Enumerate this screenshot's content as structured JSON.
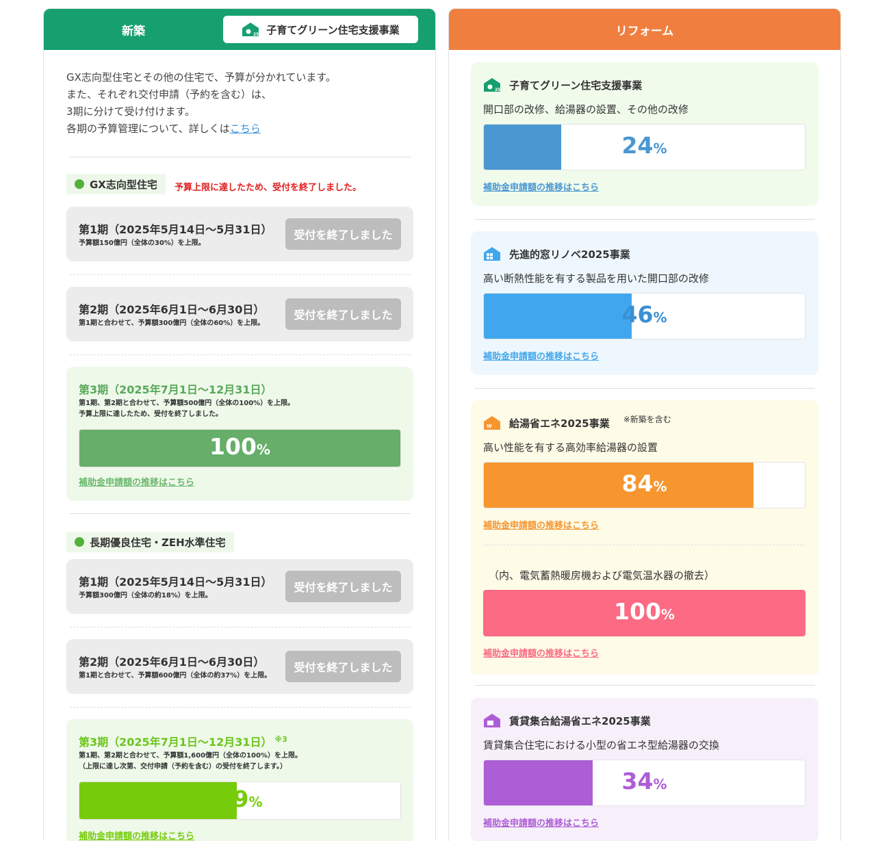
{
  "shinchiku": {
    "header": "新築",
    "tab_label": "子育てグリーン住宅支援事業",
    "intro": {
      "line1": "GX志向型住宅とその他の住宅で、予算が分かれています。",
      "line2": "また、それぞれ交付申請（予約を含む）は、",
      "line3": "3期に分けて受け付けます。",
      "line4_pre": "各期の予算管理について、詳しくは",
      "line4_link": "こちら"
    },
    "gx": {
      "label": "GX志向型住宅",
      "notice": "予算上限に達したため、受付を終了しました。",
      "p1_title": "第1期（2025年5月14日～5月31日）",
      "p1_sub": "予算額150億円（全体の30%）を上限。",
      "p2_title": "第2期（2025年6月1日～6月30日）",
      "p2_sub": "第1期と合わせて、予算額300億円（全体の60%）を上限。",
      "p3_title": "第3期（2025年7月1日～12月31日）",
      "p3_sub1": "第1期、第2期と合わせて、予算額500億円（全体の100%）を上限。",
      "p3_sub2": "予算上限に達したため、受付を終了しました。",
      "p3_pct": "100",
      "p3_progress": 1.0
    },
    "zeh": {
      "label": "長期優良住宅・ZEH水準住宅",
      "p1_title": "第1期（2025年5月14日～5月31日）",
      "p1_sub": "予算額300億円（全体の約18%）を上限。",
      "p2_title": "第2期（2025年6月1日～6月30日）",
      "p2_sub": "第1期と合わせて、予算額600億円（全体の約37%）を上限。",
      "p3_title": "第3期（2025年7月1日～12月31日）",
      "p3_sup": "※3",
      "p3_sub1": "第1期、第2期と合わせて、予算額1,600億円（全体の100%）を上限。",
      "p3_sub2": "（上限に達し次第、交付申請（予約を含む）の受付を終了します。）",
      "p3_pct": "49",
      "p3_progress": 0.49
    },
    "closed_label": "受付を終了しました",
    "history_link": "補助金申請額の推移はこちら",
    "pct_unit": "%"
  },
  "reform": {
    "header": "リフォーム",
    "cards": [
      {
        "title": "子育てグリーン住宅支援事業",
        "desc": "開口部の改修、給湯器の設置、その他の改修",
        "pct": "24",
        "progress": 0.24,
        "color": "#4a97d2"
      },
      {
        "title": "先進的窓リノベ2025事業",
        "desc": "高い断熱性能を有する製品を用いた開口部の改修",
        "pct": "46",
        "progress": 0.46,
        "color": "#40a7ee"
      },
      {
        "title": "給湯省エネ2025事業",
        "note": "※新築を含む",
        "desc": "高い性能を有する高効率給湯器の設置",
        "pct": "84",
        "progress": 0.84,
        "color": "#f7952f",
        "sub_desc": "（内、電気蓄熱暖房機および電気温水器の撤去）",
        "sub_pct": "100",
        "sub_progress": 1.0,
        "sub_color": "#fc6a83"
      },
      {
        "title": "賃貸集合給湯省エネ2025事業",
        "desc": "賃貸集合住宅における小型の省エネ型給湯器の交換",
        "pct": "34",
        "progress": 0.34,
        "color": "#ad5dd6"
      }
    ],
    "history_link": "補助金申請額の推移はこちら"
  },
  "colors": {
    "green": "#16a06f",
    "orange": "#f07f3f",
    "closed": "#bdbdbd",
    "gx_bar": "#66ae69",
    "zeh_bar": "#76cc0b"
  }
}
